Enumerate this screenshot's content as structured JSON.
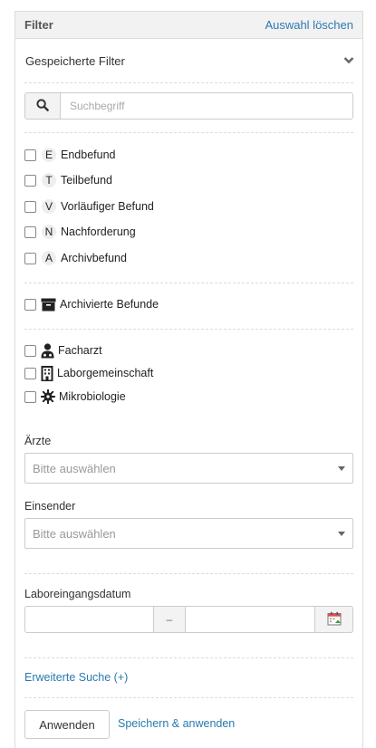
{
  "header": {
    "title": "Filter",
    "clear_label": "Auswahl löschen"
  },
  "saved_filters": {
    "label": "Gespeicherte Filter"
  },
  "search": {
    "placeholder": "Suchbegriff",
    "value": ""
  },
  "status_filters": [
    {
      "letter": "E",
      "label": "Endbefund",
      "checked": false
    },
    {
      "letter": "T",
      "label": "Teilbefund",
      "checked": false
    },
    {
      "letter": "V",
      "label": "Vorläufiger Befund",
      "checked": false
    },
    {
      "letter": "N",
      "label": "Nachforderung",
      "checked": false
    },
    {
      "letter": "A",
      "label": "Archivbefund",
      "checked": false
    }
  ],
  "archive": {
    "label": "Archivierte Befunde",
    "icon": "archive-box-icon",
    "checked": false
  },
  "categories": [
    {
      "label": "Facharzt",
      "icon": "doctor-icon",
      "checked": false
    },
    {
      "label": "Laborgemeinschaft",
      "icon": "building-icon",
      "checked": false
    },
    {
      "label": "Mikrobiologie",
      "icon": "microbe-icon",
      "checked": false
    }
  ],
  "doctors": {
    "label": "Ärzte",
    "placeholder": "Bitte auswählen"
  },
  "senders": {
    "label": "Einsender",
    "placeholder": "Bitte auswählen"
  },
  "date": {
    "label": "Laboreingangsdatum",
    "from": "",
    "to": "",
    "separator": "–"
  },
  "extended_search": {
    "label": "Erweiterte Suche (+)"
  },
  "actions": {
    "apply_label": "Anwenden",
    "save_apply_label": "Speichern & anwenden"
  },
  "colors": {
    "link": "#2a7ab0",
    "header_bg": "#f2f2f2",
    "border": "#dcdcdc"
  }
}
